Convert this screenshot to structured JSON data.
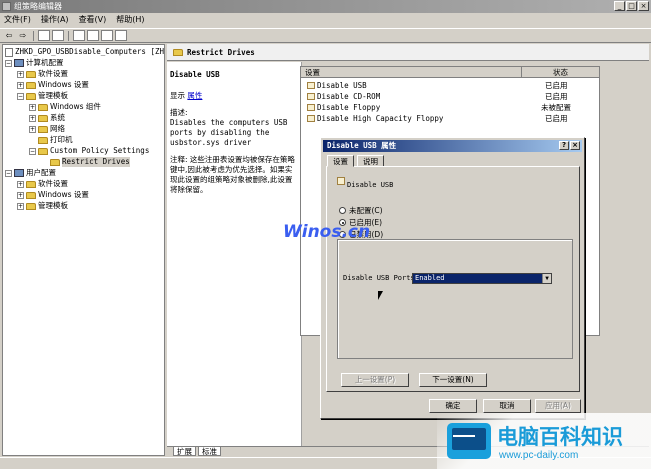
{
  "window": {
    "title": "组策略编辑器"
  },
  "menubar": [
    "文件(F)",
    "操作(A)",
    "查看(V)",
    "帮助(H)"
  ],
  "toolbar": {
    "back": "⇦",
    "forward": "⇨"
  },
  "tree": {
    "root": "ZHKD_GPO_USBDisable_Computers [ZHKD01",
    "items": [
      {
        "label": "计算机配置",
        "expander": "−"
      },
      {
        "label": "软件设置",
        "expander": "+"
      },
      {
        "label": "Windows 设置",
        "expander": "+"
      },
      {
        "label": "管理模板",
        "expander": "−"
      },
      {
        "label": "Windows 组件",
        "expander": "+"
      },
      {
        "label": "系统",
        "expander": "+"
      },
      {
        "label": "网络",
        "expander": "+"
      },
      {
        "label": "打印机",
        "expander": ""
      },
      {
        "label": "Custom Policy Settings",
        "expander": "−"
      },
      {
        "label": "Restrict Drives",
        "expander": ""
      },
      {
        "label": "用户配置",
        "expander": "−"
      },
      {
        "label": "软件设置",
        "expander": "+"
      },
      {
        "label": "Windows 设置",
        "expander": "+"
      },
      {
        "label": "管理模板",
        "expander": "+"
      }
    ]
  },
  "header": {
    "title": "Restrict Drives"
  },
  "details": {
    "policy_name": "Disable USB",
    "show_label": "显示",
    "properties_link": "属性",
    "desc_title": "描述:",
    "description": "Disables the computers USB ports by disabling the usbstor.sys driver",
    "note": "注释: 这些注册表设置均被保存在策略键中,因此被考虑为优先选择。如果实现此设置的组策略对象被删除,此设置将除保留。"
  },
  "list": {
    "col_setting": "设置",
    "col_state": "状态",
    "rows": [
      {
        "name": "Disable USB",
        "state": "已启用"
      },
      {
        "name": "Disable CD-ROM",
        "state": "已启用"
      },
      {
        "name": "Disable Floppy",
        "state": "未被配置"
      },
      {
        "name": "Disable High Capacity Floppy",
        "state": "已启用"
      }
    ]
  },
  "dialog": {
    "title": "Disable USB 属性",
    "help_btn": "?",
    "close_btn": "×",
    "tab_settings": "设置",
    "tab_explain": "说明",
    "policy_label": "Disable USB",
    "radio_not_configured": "未配置(C)",
    "radio_enabled": "已启用(E)",
    "radio_disabled": "已禁用(D)",
    "option_label": "Disable USB Ports",
    "option_value": "Enabled",
    "prev_btn": "上一设置(P)",
    "next_btn": "下一设置(N)",
    "ok_btn": "确定",
    "cancel_btn": "取消",
    "apply_btn": "应用(A)"
  },
  "bottom_tabs": {
    "extended": "扩展",
    "standard": "标准"
  },
  "watermark": "Winos.cn",
  "logo": {
    "brand": "电脑百科知识",
    "url": "www.pc-daily.com"
  }
}
